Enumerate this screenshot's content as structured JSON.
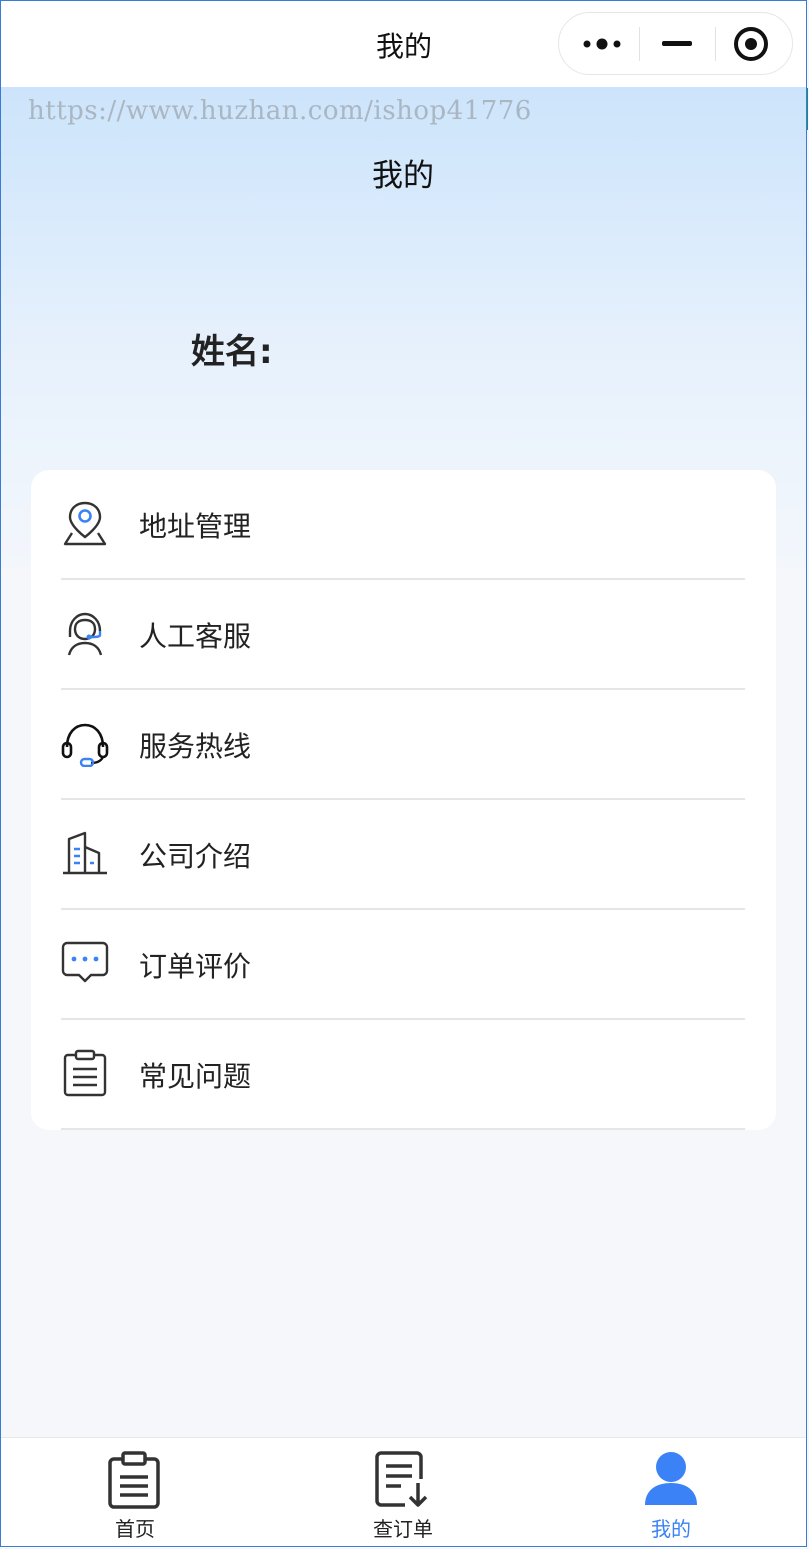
{
  "topbar": {
    "title": "我的"
  },
  "watermark": "https://www.huzhan.com/ishop41776",
  "header": {
    "title": "我的",
    "name_label": "姓名:"
  },
  "menu": [
    {
      "label": "地址管理",
      "icon": "location-pin-icon"
    },
    {
      "label": "人工客服",
      "icon": "customer-service-icon"
    },
    {
      "label": "服务热线",
      "icon": "headset-icon"
    },
    {
      "label": "公司介绍",
      "icon": "building-icon"
    },
    {
      "label": "订单评价",
      "icon": "chat-bubble-icon"
    },
    {
      "label": "常见问题",
      "icon": "clipboard-icon"
    }
  ],
  "tabs": [
    {
      "label": "首页",
      "icon": "clipboard-icon",
      "active": false
    },
    {
      "label": "查订单",
      "icon": "order-download-icon",
      "active": false
    },
    {
      "label": "我的",
      "icon": "user-icon",
      "active": true
    }
  ],
  "colors": {
    "accent": "#3b82f6",
    "gradient_top": "#cce4fb",
    "background": "#f5f7fa"
  }
}
